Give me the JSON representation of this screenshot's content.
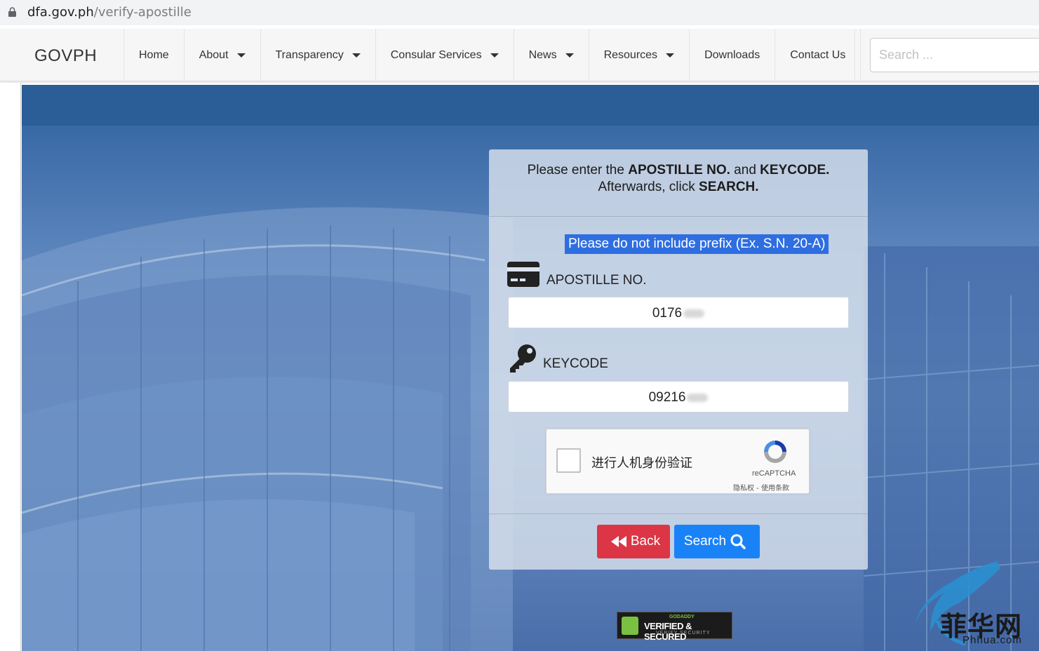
{
  "browser": {
    "url_domain": "dfa.gov.ph",
    "url_path": "/verify-apostille"
  },
  "nav": {
    "brand": "GOVPH",
    "items": [
      {
        "label": "Home",
        "dropdown": false
      },
      {
        "label": "About",
        "dropdown": true
      },
      {
        "label": "Transparency",
        "dropdown": true
      },
      {
        "label": "Consular Services",
        "dropdown": true
      },
      {
        "label": "News",
        "dropdown": true
      },
      {
        "label": "Resources",
        "dropdown": true
      },
      {
        "label": "Downloads",
        "dropdown": false
      },
      {
        "label": "Contact Us",
        "dropdown": false
      }
    ],
    "search_placeholder": "Search ..."
  },
  "form": {
    "instruction_prefix": "Please enter the ",
    "instruction_apostille": "APOSTILLE NO.",
    "instruction_and": " and ",
    "instruction_keycode": "KEYCODE.",
    "instruction_after": "Afterwards, click ",
    "instruction_search": "SEARCH.",
    "hint": "Please do not include prefix (Ex. S.N. 20-A)",
    "apostille_label": "APOSTILLE NO.",
    "apostille_value": "0176",
    "keycode_label": "KEYCODE",
    "keycode_value": "09216",
    "recaptcha_text": "进行人机身份验证",
    "recaptcha_brand": "reCAPTCHA",
    "recaptcha_links": "隐私权 - 使用条款",
    "back_label": "Back",
    "search_label": "Search"
  },
  "badge": {
    "line1": "GODADDY",
    "line2": "VERIFIED & SECURED",
    "line3": "VERIFY SECURITY"
  },
  "watermark": {
    "text": "菲华网",
    "url": "Phhua.com"
  },
  "colors": {
    "back_button": "#dc3545",
    "search_button": "#1a82f7",
    "hint_highlight": "#2f6ee0"
  }
}
